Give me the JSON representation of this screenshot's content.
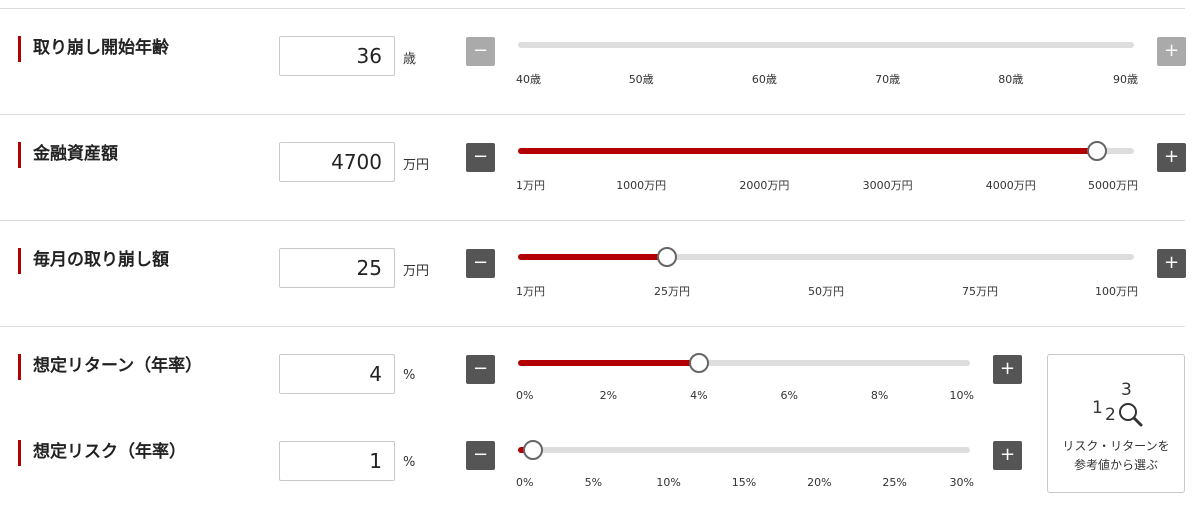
{
  "rows": [
    {
      "label": "取り崩し開始年齢",
      "value": "36",
      "unit": "歳",
      "minus_label": "−",
      "plus_label": "+",
      "buttons_disabled": true,
      "min": 40,
      "max": 90,
      "current": 36,
      "ticks": [
        "40歳",
        "50歳",
        "60歳",
        "70歳",
        "80歳",
        "90歳"
      ]
    },
    {
      "label": "金融資産額",
      "value": "4700",
      "unit": "万円",
      "minus_label": "−",
      "plus_label": "+",
      "buttons_disabled": false,
      "min": 1,
      "max": 5000,
      "current": 4700,
      "ticks": [
        "1万円",
        "1000万円",
        "2000万円",
        "3000万円",
        "4000万円",
        "5000万円"
      ]
    },
    {
      "label": "毎月の取り崩し額",
      "value": "25",
      "unit": "万円",
      "minus_label": "−",
      "plus_label": "+",
      "buttons_disabled": false,
      "min": 1,
      "max": 100,
      "current": 25,
      "ticks": [
        "1万円",
        "25万円",
        "50万円",
        "75万円",
        "100万円"
      ]
    },
    {
      "label": "想定リターン（年率）",
      "value": "4",
      "unit": "%",
      "minus_label": "−",
      "plus_label": "+",
      "buttons_disabled": false,
      "min": 0,
      "max": 10,
      "current": 4,
      "ticks": [
        "0%",
        "2%",
        "4%",
        "6%",
        "8%",
        "10%"
      ]
    },
    {
      "label": "想定リスク（年率）",
      "value": "1",
      "unit": "%",
      "minus_label": "−",
      "plus_label": "+",
      "buttons_disabled": false,
      "min": 0,
      "max": 30,
      "current": 1,
      "ticks": [
        "0%",
        "5%",
        "10%",
        "15%",
        "20%",
        "25%",
        "30%"
      ]
    }
  ],
  "reference_button": {
    "icon_digits": [
      "1",
      "2",
      "3"
    ],
    "line1": "リスク・リターンを",
    "line2": "参考値から選ぶ"
  },
  "colors": {
    "accent": "#b30000",
    "button": "#555555",
    "button_disabled": "#aaaaaa",
    "track": "#dddddd"
  }
}
